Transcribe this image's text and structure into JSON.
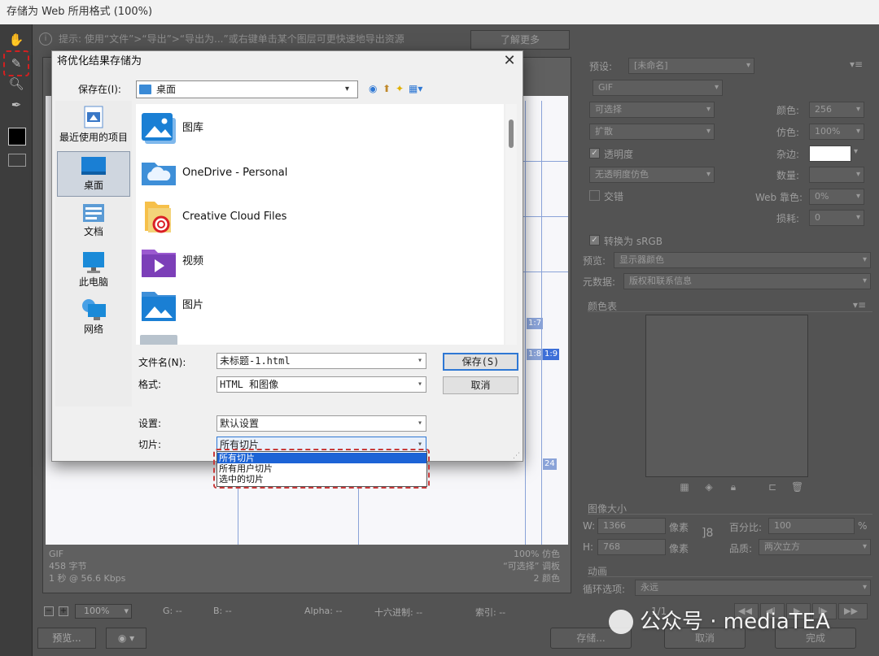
{
  "window": {
    "title": "存储为 Web 所用格式 (100%)"
  },
  "hint": {
    "text": "提示: 使用“文件”>“导出”>“导出为...”或右键单击某个图层可更快速地导出资源",
    "learn_more": "了解更多"
  },
  "canvas": {
    "slice_tags": [
      "1:7",
      "1:8",
      "1:9",
      "24"
    ],
    "info_left": [
      "GIF",
      "458 字节",
      "1 秒 @ 56.6 Kbps"
    ],
    "info_right": [
      "100% 仿色",
      "“可选择” 调板",
      "2 颜色"
    ]
  },
  "statusbar": {
    "zoom": "100%",
    "g": "G: --",
    "b": "B: --",
    "alpha": "Alpha: --",
    "hex": "十六进制: --",
    "index": "索引: --"
  },
  "bottom_buttons": {
    "preview": "预览...",
    "save": "存储...",
    "cancel": "取消",
    "done": "完成"
  },
  "settings_panel": {
    "preset_label": "预设:",
    "preset_value": "[未命名]",
    "format": "GIF",
    "reduction": "可选择",
    "dither_algo": "扩散",
    "transparency_label": "透明度",
    "trans_dither": "无透明度仿色",
    "interlaced_label": "交错",
    "colors_label": "颜色:",
    "colors_value": "256",
    "dither_label": "仿色:",
    "dither_value": "100%",
    "matte_label": "杂边:",
    "amount_label": "数量:",
    "web_snap_label": "Web 靠色:",
    "web_snap_value": "0%",
    "lossy_label": "损耗:",
    "lossy_value": "0",
    "convert_srgb_label": "转换为 sRGB",
    "preview_label": "预览:",
    "preview_value": "显示器颜色",
    "metadata_label": "元数据:",
    "metadata_value": "版权和联系信息",
    "color_table_title": "颜色表",
    "image_size_title": "图像大小",
    "w_label": "W:",
    "w_value": "1366",
    "h_label": "H:",
    "h_value": "768",
    "px_unit": "像素",
    "percent_label": "百分比:",
    "percent_value": "100",
    "percent_unit": "%",
    "quality_label": "品质:",
    "quality_value": "两次立方",
    "animation_title": "动画",
    "loop_label": "循环选项:",
    "loop_value": "永远",
    "frame_counter": "1/1"
  },
  "dialog": {
    "title": "将优化结果存储为",
    "save_in_label": "保存在(I):",
    "save_in_value": "桌面",
    "places": [
      {
        "label": "最近使用的项目",
        "icon": "recent-icon"
      },
      {
        "label": "桌面",
        "icon": "desktop-icon"
      },
      {
        "label": "文档",
        "icon": "documents-icon"
      },
      {
        "label": "此电脑",
        "icon": "this-pc-icon"
      },
      {
        "label": "网络",
        "icon": "network-icon"
      }
    ],
    "files": [
      {
        "name": "图库",
        "icon": "gallery-icon"
      },
      {
        "name": "OneDrive - Personal",
        "icon": "onedrive-icon"
      },
      {
        "name": "Creative Cloud Files",
        "icon": "creative-cloud-folder-icon"
      },
      {
        "name": "视频",
        "icon": "videos-folder-icon"
      },
      {
        "name": "图片",
        "icon": "pictures-folder-icon"
      }
    ],
    "filename_label": "文件名(N):",
    "filename_value": "未标题-1.html",
    "format_label": "格式:",
    "format_value": "HTML 和图像",
    "settings_label": "设置:",
    "settings_value": "默认设置",
    "slices_label": "切片:",
    "slices_value": "所有切片",
    "slices_options": [
      "所有切片",
      "所有用户切片",
      "选中的切片"
    ],
    "save_button": "保存(S)",
    "cancel_button": "取消"
  },
  "watermark": {
    "text": "公众号 · mediaTEA"
  },
  "colors": {
    "dialog_bg": "#f0f0f0",
    "selection_blue": "#1c63d6",
    "highlight_red": "#c83a3a",
    "app_bg": "#535353",
    "slice_blue": "#8aa3d8"
  }
}
